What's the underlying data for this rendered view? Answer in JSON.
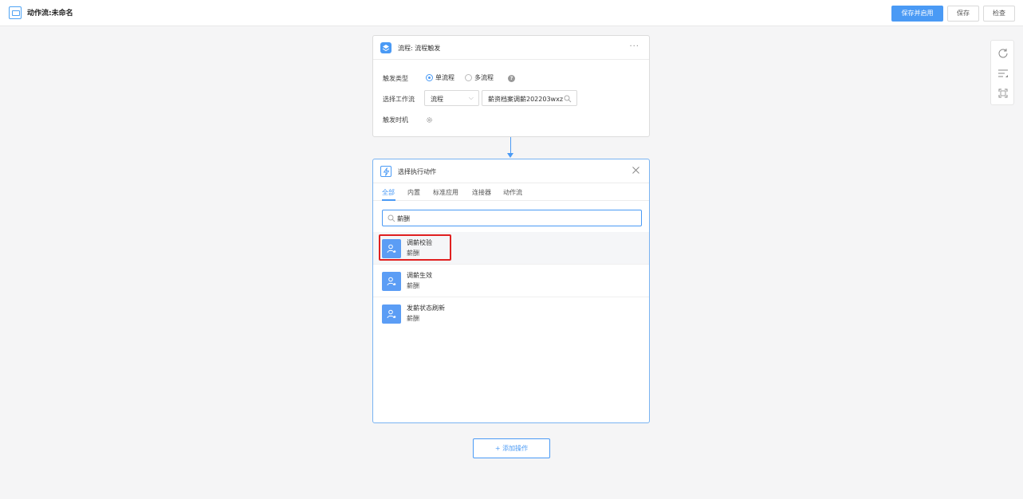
{
  "header": {
    "title": "动作流:未命名",
    "save_enable_label": "保存并启用",
    "save_label": "保存",
    "check_label": "检查"
  },
  "toolbar_right": {
    "icons": [
      "refresh-icon",
      "sort-icon",
      "fit-screen-icon"
    ]
  },
  "trigger_card": {
    "title": "流程: 流程触发",
    "more": "···",
    "trigger_type_label": "触发类型",
    "option_single": "单流程",
    "option_multi": "多流程",
    "selected_option": "单流程",
    "help": "?",
    "select_workflow_label": "选择工作流",
    "workflow_type_value": "流程",
    "workflow_name_value": "薪资档案调薪202203wxz",
    "trigger_time_label": "触发时机"
  },
  "action_card": {
    "title": "选择执行动作",
    "tabs": [
      {
        "label": "全部"
      },
      {
        "label": "内置"
      },
      {
        "label": "标准应用"
      },
      {
        "label": "连接器"
      },
      {
        "label": "动作流"
      }
    ],
    "active_tab": "全部",
    "search_value": "薪酬",
    "items": [
      {
        "title": "调薪校验",
        "subtitle": "薪酬"
      },
      {
        "title": "调薪生效",
        "subtitle": "薪酬"
      },
      {
        "title": "发薪状态刷新",
        "subtitle": "薪酬"
      }
    ]
  },
  "add_action_label": "+ 添加操作",
  "colors": {
    "accent": "#4a9af5",
    "highlight": "#e02020",
    "background": "#f5f5f6"
  }
}
